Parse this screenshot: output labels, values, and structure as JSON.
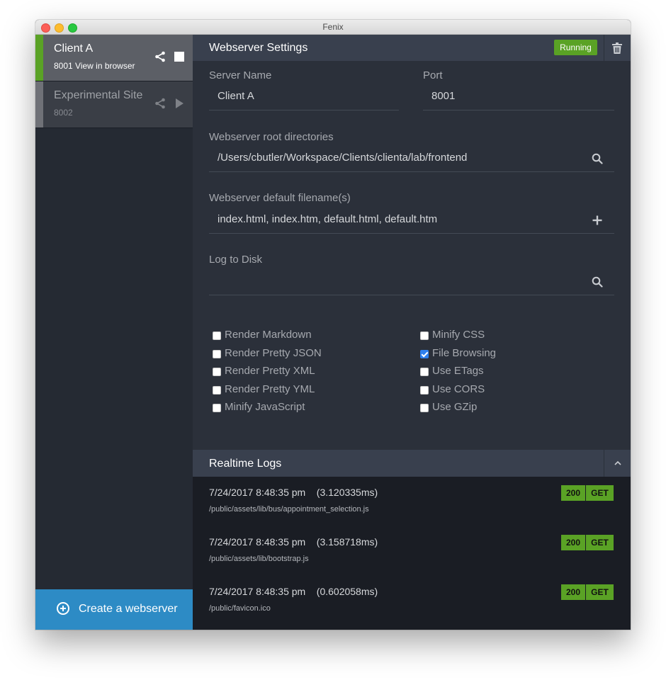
{
  "window": {
    "title": "Fenix"
  },
  "sidebar": {
    "servers": [
      {
        "name": "Client A",
        "subtitle": "8001 View in browser",
        "state": "running"
      },
      {
        "name": "Experimental Site",
        "subtitle": "8002",
        "state": "stopped"
      }
    ],
    "create_label": "Create a webserver"
  },
  "main": {
    "header": {
      "title": "Webserver Settings",
      "status": "Running"
    },
    "form": {
      "server_name_label": "Server Name",
      "server_name_value": "Client A",
      "port_label": "Port",
      "port_value": "8001",
      "root_dirs_label": "Webserver root directories",
      "root_dirs_value": "/Users/cbutler/Workspace/Clients/clienta/lab/frontend",
      "default_files_label": "Webserver default filename(s)",
      "default_files_value": "index.html, index.htm, default.html, default.htm",
      "log_label": "Log to Disk",
      "log_value": ""
    },
    "options_left": [
      {
        "label": "Render Markdown",
        "checked": false
      },
      {
        "label": "Render Pretty JSON",
        "checked": false
      },
      {
        "label": "Render Pretty XML",
        "checked": false
      },
      {
        "label": "Render Pretty YML",
        "checked": false
      },
      {
        "label": "Minify JavaScript",
        "checked": false
      }
    ],
    "options_right": [
      {
        "label": "Minify CSS",
        "checked": false
      },
      {
        "label": "File Browsing",
        "checked": true
      },
      {
        "label": "Use ETags",
        "checked": false
      },
      {
        "label": "Use CORS",
        "checked": false
      },
      {
        "label": "Use GZip",
        "checked": false
      }
    ],
    "logs_title": "Realtime Logs",
    "logs": [
      {
        "time": "7/24/2017 8:48:35 pm    (3.120335ms)",
        "path": "/public/assets/lib/bus/appointment_selection.js",
        "status": "200",
        "method": "GET"
      },
      {
        "time": "7/24/2017 8:48:35 pm    (3.158718ms)",
        "path": "/public/assets/lib/bootstrap.js",
        "status": "200",
        "method": "GET"
      },
      {
        "time": "7/24/2017 8:48:35 pm    (0.602058ms)",
        "path": "/public/favicon.ico",
        "status": "200",
        "method": "GET"
      }
    ]
  },
  "colors": {
    "accent_green": "#5aa225",
    "accent_blue": "#2d8bc5",
    "header_bg": "#39404e",
    "panel_bg": "#2b303a",
    "sidebar_bg": "#252a33",
    "log_bg": "#1a1d24"
  }
}
